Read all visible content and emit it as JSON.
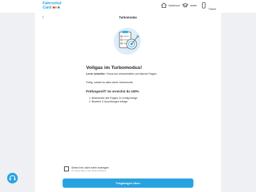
{
  "app": {
    "logo_line1": "Fahrschul",
    "logo_line2": "Card",
    "logo_dot_colors": [
      "#e63946",
      "#f4a261",
      "#2a9d8f"
    ]
  },
  "nav": [
    {
      "label": "Dashboard",
      "icon": "home-icon"
    },
    {
      "label": "Inhalte",
      "icon": "graduation-cap-icon"
    },
    {
      "label": "Theorie",
      "icon": "phone-icon"
    }
  ],
  "page": {
    "back_label": "‹",
    "title": "Turbomodus"
  },
  "content": {
    "heading": "Vollgas im Turbomodus!",
    "intro_bold": "Lerne schneller:",
    "intro_text": " Fokus auf unbearbeitete und falsche Fragen.",
    "done_text": "Fertig, sobald du alles sicher beherrschst.",
    "subheading": "Prüfungsreif? So erreichst du 100%",
    "steps": [
      "Beantworte alle Fragen 2x richtig infolge.",
      "Bestehe 3 Vorprüfungen infolge."
    ]
  },
  "footer": {
    "checkbox_label": "Diese Info nicht mehr anzeigen",
    "checkbox_hint": "Du kannst alles in den FAQs nachlesen.",
    "checkbox_checked": false,
    "cta_label": "Fragebogen üben"
  },
  "colors": {
    "accent": "#29a3e0",
    "background": "#eef0f3"
  }
}
